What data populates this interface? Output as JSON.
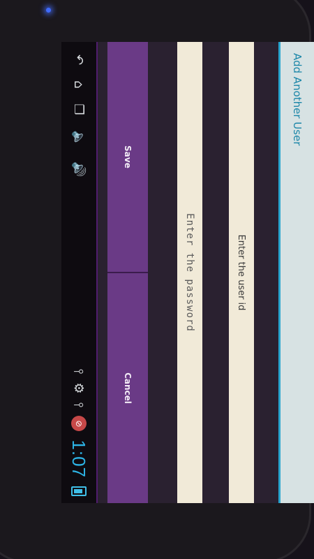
{
  "dialog": {
    "title": "Add Another User",
    "user_id_placeholder": "Enter the user id",
    "password_placeholder": "Enter the password",
    "save_label": "Save",
    "cancel_label": "Cancel"
  },
  "status_bar": {
    "time": "1:07"
  },
  "icons": {
    "back": "back-icon",
    "home": "home-icon",
    "recents": "recent-apps-icon",
    "volume_down": "volume-down-icon",
    "volume_up": "volume-up-icon",
    "usb": "usb-icon",
    "android": "android-icon",
    "no_signal": "no-sim-icon",
    "battery": "battery-icon"
  },
  "colors": {
    "title_text": "#1b86a8",
    "title_line": "#2aa6cf",
    "button_bg": "#6a3a86",
    "clock": "#2db4e6",
    "wallpaper": "#4a1b66"
  }
}
